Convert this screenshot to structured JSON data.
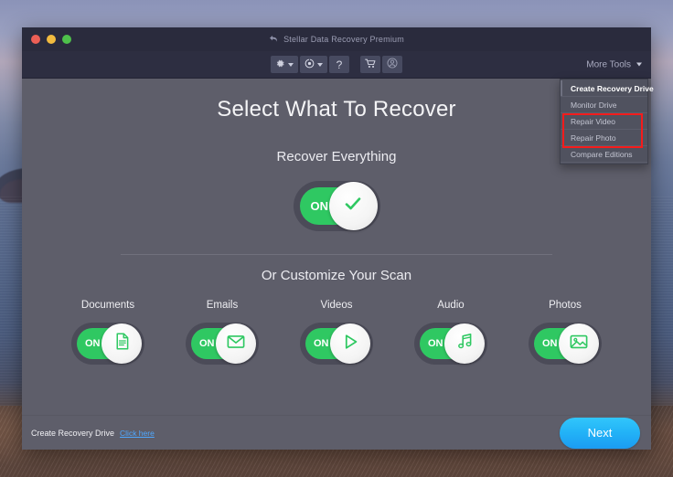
{
  "window": {
    "title": "Stellar Data Recovery Premium",
    "back_icon": "back-arrow-icon",
    "traffic_lights": [
      "close",
      "minimize",
      "maximize"
    ]
  },
  "toolbar": {
    "items": [
      {
        "icon": "gear-icon",
        "has_caret": true
      },
      {
        "icon": "disc-scan-icon",
        "has_caret": true
      },
      {
        "icon": "help-question-icon",
        "label": "?"
      },
      {
        "icon": "shopping-cart-icon"
      },
      {
        "icon": "user-account-icon"
      }
    ],
    "more_tools_label": "More Tools",
    "more_tools_caret": "chevron-down-icon"
  },
  "more_tools_menu": {
    "items": [
      {
        "label": "Create Recovery Drive",
        "active": true
      },
      {
        "label": "Monitor Drive",
        "active": false
      },
      {
        "label": "Repair Video",
        "active": false,
        "highlighted": true
      },
      {
        "label": "Repair Photo",
        "active": false,
        "highlighted": true
      },
      {
        "label": "Compare Editions",
        "active": false
      }
    ],
    "highlight_color": "#f61b1b"
  },
  "main": {
    "page_title": "Select What To Recover",
    "recover_everything_label": "Recover Everything",
    "master_toggle": {
      "state_label": "ON",
      "icon": "check-icon",
      "on": true
    },
    "customize_label": "Or Customize Your Scan",
    "categories": [
      {
        "label": "Documents",
        "state_label": "ON",
        "icon": "document-icon",
        "on": true
      },
      {
        "label": "Emails",
        "state_label": "ON",
        "icon": "envelope-icon",
        "on": true
      },
      {
        "label": "Videos",
        "state_label": "ON",
        "icon": "play-triangle-icon",
        "on": true
      },
      {
        "label": "Audio",
        "state_label": "ON",
        "icon": "music-note-icon",
        "on": true
      },
      {
        "label": "Photos",
        "state_label": "ON",
        "icon": "image-photo-icon",
        "on": true
      }
    ]
  },
  "footer": {
    "recovery_drive_label": "Create Recovery Drive",
    "click_here_link": "Click here",
    "next_button_label": "Next"
  },
  "colors": {
    "toggle_on_green": "#2fc862",
    "toggle_track": "#4b4b58",
    "content_bg": "#5e5e6a",
    "titlebar_bg": "#2a2b3d",
    "toolbar_bg": "#2d2e41",
    "next_blue": "#23b4f7",
    "link_blue": "#4fa8ff",
    "highlight_red": "#f61b1b"
  }
}
